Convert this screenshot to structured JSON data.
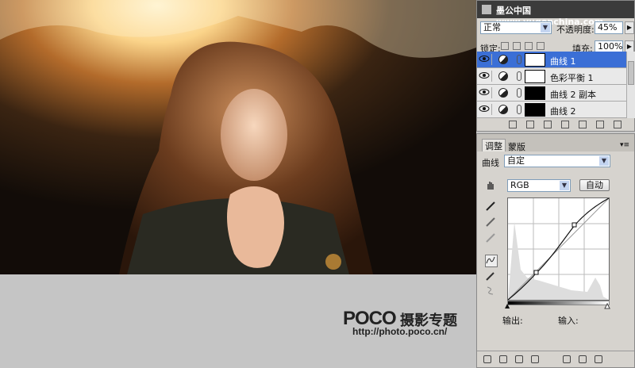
{
  "layers_panel": {
    "site_header": "墨公中国 www.yugonchina.com",
    "blend_mode": "正常",
    "opacity_label": "不透明度:",
    "opacity_value": "45%",
    "lock_label": "锁定:",
    "fill_label": "填充:",
    "fill_value": "100%",
    "layers": [
      {
        "name": "曲线 1",
        "active": true
      },
      {
        "name": "色彩平衡 1",
        "active": false
      },
      {
        "name": "曲线 2 副本",
        "active": false
      },
      {
        "name": "曲线 2",
        "active": false
      }
    ]
  },
  "adjustments_panel": {
    "tabs": [
      "调整",
      "蒙版"
    ],
    "adjustment_label": "曲线",
    "preset_value": "自定",
    "channel_value": "RGB",
    "auto_button": "自动",
    "output_label": "输出:",
    "input_label": "输入:"
  },
  "watermark": {
    "logo": "POCO",
    "title": "摄影专题",
    "url": "http://photo.poco.cn/"
  },
  "colors": {
    "selection": "#3b6fd6",
    "panel_bg": "#d6d3ce",
    "canvas_gray": "#c5c5c5"
  }
}
